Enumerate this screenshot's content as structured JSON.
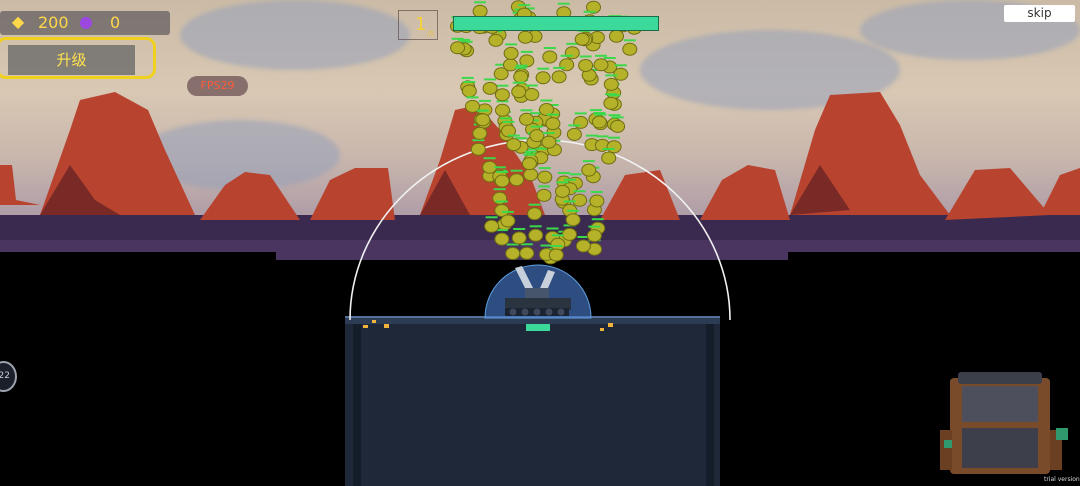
{
  "hud": {
    "gold_icon": "gold-crystal-icon",
    "gold": "200",
    "gem_icon": "purple-gem-icon",
    "gems": "0",
    "upgrade_label": "升级",
    "fps_label": "FPS29",
    "wave_number": "1",
    "wave_unit": "/5",
    "boss_health_fraction": 1.0,
    "skip_label": "skip",
    "side_button_label": "22",
    "trial_label": "trial version"
  },
  "scene": {
    "tank_icon": "tank-icon",
    "shield_icon": "energy-dome-icon",
    "backpack_icon": "backpack-icon",
    "enemy_icon": "spiky-spore-enemy-icon"
  },
  "colors": {
    "gold": "#ffd84a",
    "upgrade_border": "#f0d21e",
    "health": "#3bd99a",
    "enemy": "#b5b22a",
    "rock": "#b8432f",
    "ground": "#1f2838"
  }
}
